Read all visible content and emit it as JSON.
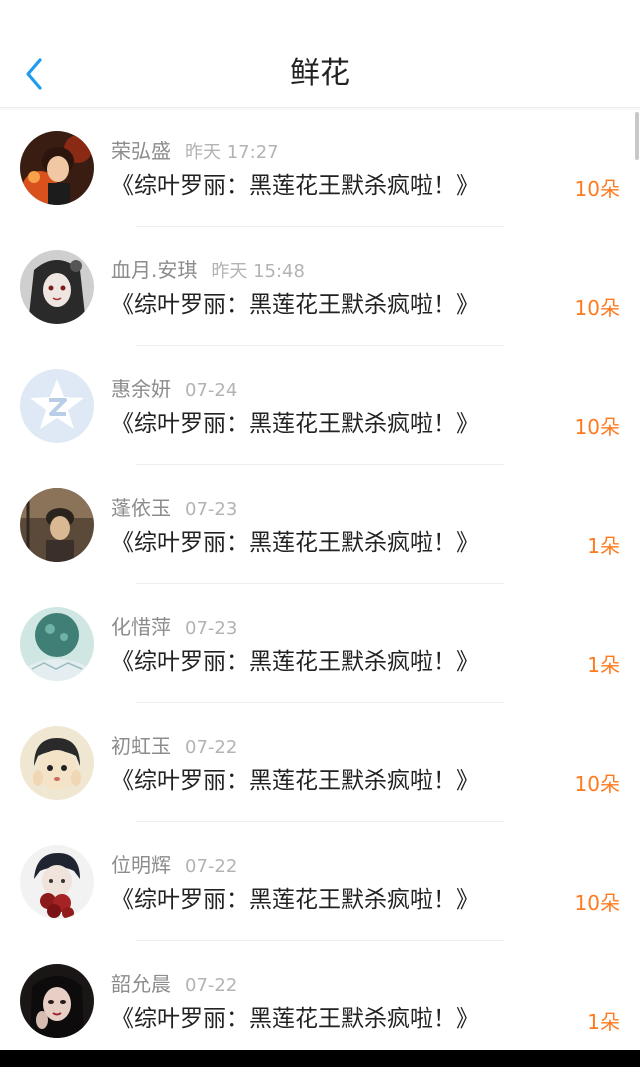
{
  "header": {
    "title": "鲜花",
    "back_icon": "chevron-left-icon"
  },
  "colors": {
    "accent": "#1e9bf0",
    "count": "#ff7a1f",
    "name": "#8c8c8c",
    "time": "#b3b3b3",
    "text": "#222222"
  },
  "items": [
    {
      "name": "荣弘盛",
      "time": "昨天 17:27",
      "book": "《综叶罗丽：黑莲花王默杀疯啦！》",
      "count": "10朵"
    },
    {
      "name": "血月.安琪",
      "time": "昨天 15:48",
      "book": "《综叶罗丽：黑莲花王默杀疯啦！》",
      "count": "10朵"
    },
    {
      "name": "惠余妍",
      "time": "07-24",
      "book": "《综叶罗丽：黑莲花王默杀疯啦！》",
      "count": "10朵"
    },
    {
      "name": "蓬依玉",
      "time": "07-23",
      "book": "《综叶罗丽：黑莲花王默杀疯啦！》",
      "count": "1朵"
    },
    {
      "name": "化惜萍",
      "time": "07-23",
      "book": "《综叶罗丽：黑莲花王默杀疯啦！》",
      "count": "1朵"
    },
    {
      "name": "初虹玉",
      "time": "07-22",
      "book": "《综叶罗丽：黑莲花王默杀疯啦！》",
      "count": "10朵"
    },
    {
      "name": "位明辉",
      "time": "07-22",
      "book": "《综叶罗丽：黑莲花王默杀疯啦！》",
      "count": "10朵"
    },
    {
      "name": "韶允晨",
      "time": "07-22",
      "book": "《综叶罗丽：黑莲花王默杀疯啦！》",
      "count": "1朵"
    }
  ]
}
